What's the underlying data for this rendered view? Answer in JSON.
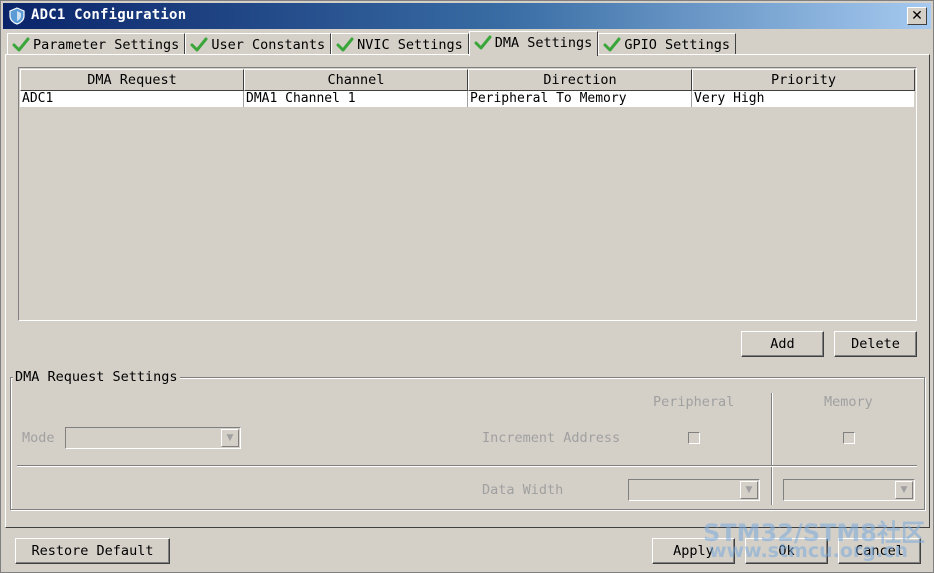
{
  "window": {
    "title": "ADC1 Configuration",
    "close_label": "✕"
  },
  "tabs": [
    {
      "label": "Parameter Settings"
    },
    {
      "label": "User Constants"
    },
    {
      "label": "NVIC Settings"
    },
    {
      "label": "DMA Settings",
      "active": true
    },
    {
      "label": "GPIO Settings"
    }
  ],
  "table": {
    "columns": [
      "DMA Request",
      "Channel",
      "Direction",
      "Priority"
    ],
    "rows": [
      [
        "ADC1",
        "DMA1 Channel 1",
        "Peripheral To Memory",
        "Very High"
      ]
    ]
  },
  "buttons": {
    "add": "Add",
    "delete": "Delete"
  },
  "dma_request_settings": {
    "title": "DMA Request Settings",
    "mode_label": "Mode",
    "peripheral_header": "Peripheral",
    "memory_header": "Memory",
    "increment_address_label": "Increment Address",
    "data_width_label": "Data Width"
  },
  "footer": {
    "restore_default": "Restore Default",
    "apply": "Apply",
    "ok": "Ok",
    "cancel": "Cancel"
  },
  "watermark": {
    "line1": "STM32/STM8社区",
    "line2": "www.stmcu.org.cn"
  },
  "colors": {
    "title_start": "#0a246a",
    "title_end": "#a6caf0",
    "check_green": "#3aa63a"
  }
}
